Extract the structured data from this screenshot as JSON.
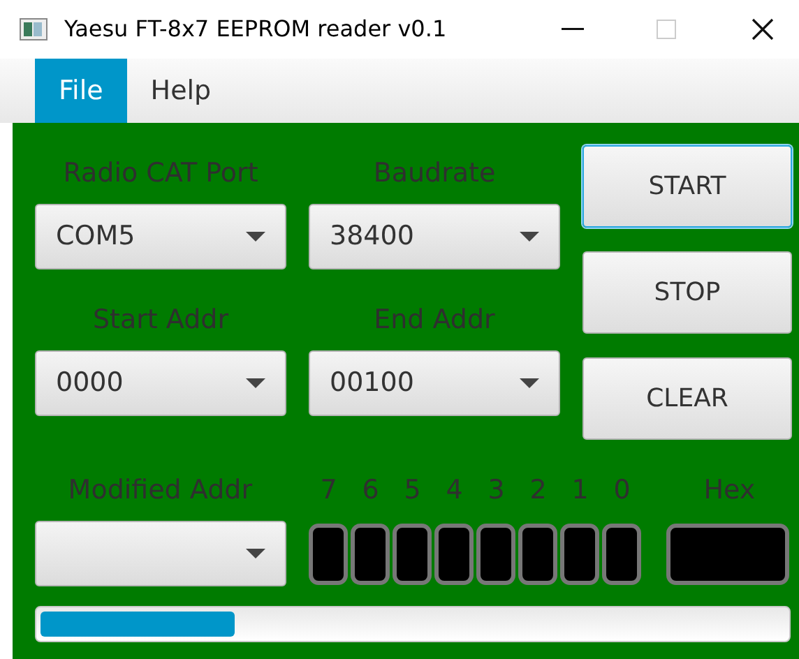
{
  "window": {
    "title": "Yaesu FT-8x7 EEPROM reader v0.1"
  },
  "menu": [
    {
      "label": "File",
      "selected": true
    },
    {
      "label": "Help",
      "selected": false
    }
  ],
  "fields": [
    {
      "label": "Radio CAT Port",
      "value": "COM5"
    },
    {
      "label": "Baudrate",
      "value": "38400"
    },
    {
      "label": "Start Addr",
      "value": "0000"
    },
    {
      "label": "End Addr",
      "value": "00100"
    }
  ],
  "buttons": [
    {
      "label": "START",
      "focused": true
    },
    {
      "label": "STOP",
      "focused": false
    },
    {
      "label": "CLEAR",
      "focused": false
    }
  ],
  "modified_addr": {
    "label": "Modified Addr"
  },
  "bits": [
    "7",
    "6",
    "5",
    "4",
    "3",
    "2",
    "1",
    "0"
  ],
  "hex": {
    "label": "Hex"
  },
  "progress": {
    "level": 0.26
  }
}
